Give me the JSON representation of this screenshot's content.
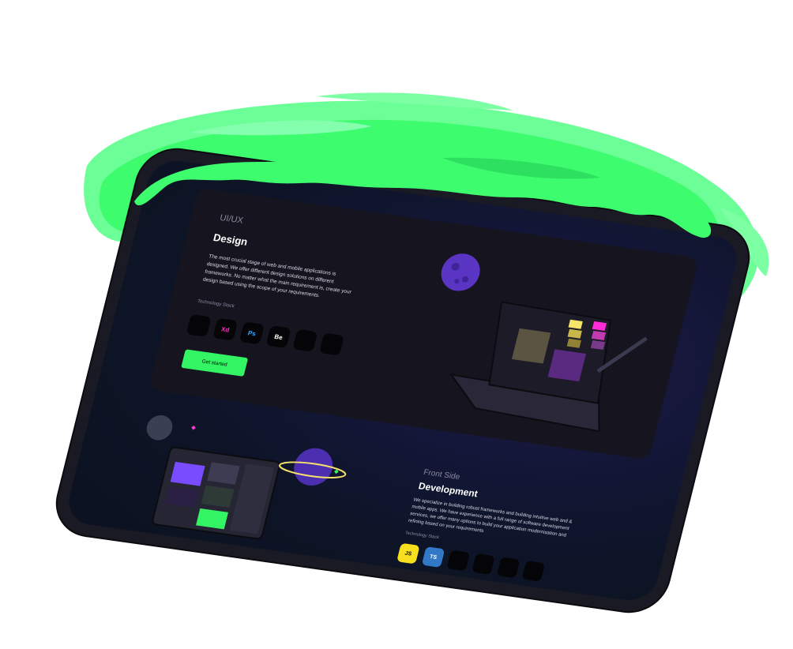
{
  "design_section": {
    "category": "UI/UX",
    "title": "Design",
    "description": "The most crucial stage of web and mobile applications is designed. We offer different design solutions on different frameworks. No matter what the main requirement is, create your design based using the scope of your requirements.",
    "tech_stack_label": "Technology Stack",
    "tools": [
      {
        "icon": "sketch-icon",
        "label": "",
        "color": "#f7b500"
      },
      {
        "icon": "adobe-xd-icon",
        "label": "Xd",
        "color": "#ff2bc2"
      },
      {
        "icon": "photoshop-icon",
        "label": "Ps",
        "color": "#31a8ff"
      },
      {
        "icon": "behance-icon",
        "label": "Be",
        "color": "#1769ff"
      },
      {
        "icon": "figma-icon",
        "label": "",
        "color": "#a259ff"
      },
      {
        "icon": "framer-icon",
        "label": "",
        "color": "#f2994a"
      }
    ],
    "cta_label": "Get started"
  },
  "development_section": {
    "category": "Front Side",
    "title": "Development",
    "description": "We specialize in building robust frameworks and building intuitive web and & mobile apps. We have experience with a full range of software development services, we offer many options to build your application modernisation and refining based on your requirements",
    "tech_stack_label": "Technology Stack",
    "tools": [
      {
        "icon": "javascript-icon",
        "label": "JS",
        "color": "#f7df1e"
      },
      {
        "icon": "typescript-icon",
        "label": "TS",
        "color": "#3178c6"
      },
      {
        "icon": "mariadb-icon",
        "label": "",
        "color": "#6ba4d8"
      },
      {
        "icon": "react-icon",
        "label": "",
        "color": "#61dafb"
      },
      {
        "icon": "flutter-icon",
        "label": "",
        "color": "#4fc3f7"
      },
      {
        "icon": "angular-icon",
        "label": "",
        "color": "#dd0031"
      }
    ]
  },
  "colors": {
    "accent_green": "#33f564",
    "card_bg": "#16141e",
    "screen_bg": "#0d1426"
  }
}
